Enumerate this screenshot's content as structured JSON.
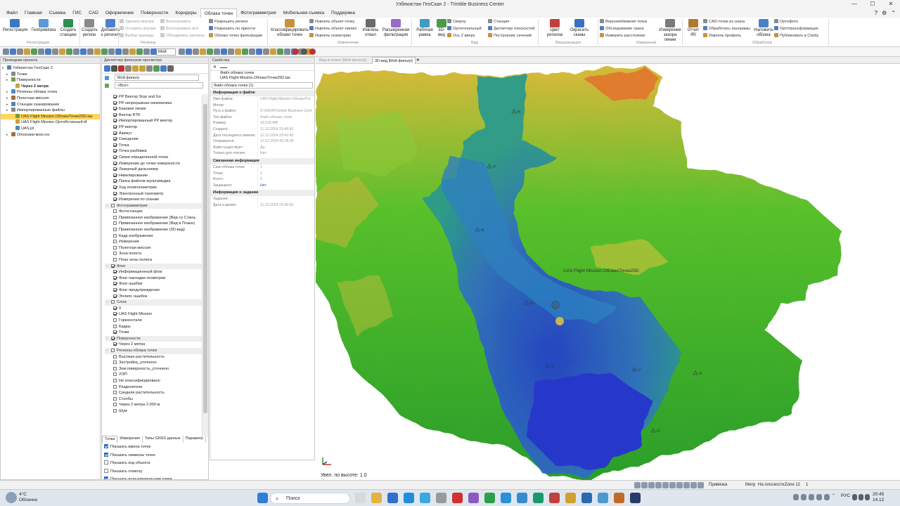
{
  "window": {
    "title": "Узбекистан ГеоСкан 2 - Trimble Business Center"
  },
  "menu": [
    "Файл",
    "Главная",
    "Съемка",
    "ГИС",
    "CAD",
    "Оформление",
    "Поверхности",
    "Коридоры",
    "Облака точек",
    "Фотограмметрия",
    "Мобильная съемка",
    "Поддержка"
  ],
  "active_menu": "Облака точек",
  "ribbon": {
    "big_buttons": [
      "Регистрация",
      "Геопривязка",
      "Создать станцию",
      "Создать регион",
      "Добавить к региону",
      "Классифицировать облако точек",
      "Извлечь отвал",
      "Расширенная фильтрация",
      "Рабочая рамка",
      "3D-вид",
      "Цвет региона",
      "Окрасить сканы",
      "Измерение зазора линии",
      "Отчет IRI",
      "Наложить облака"
    ],
    "small": {
      "col1": [
        "Удалить внутри",
        "Оставить внутри",
        "Выбор границы"
      ],
      "col2": [
        "Восстановить",
        "Восстановить все",
        "Объединить регионы"
      ],
      "col3": [
        "Разрешить регион",
        "Разрешить по яркости",
        "Облако точек фильтрации"
      ],
      "col4": [
        "Извлечь объект-точку",
        "Извлечь объект-линию",
        "Извлечь геометрию"
      ],
      "col5": [
        "Сверху",
        "Ортогональный",
        "Ось Z вверх"
      ],
      "col6": [
        "Станция",
        "Диспетчер плоскостей",
        "Построение сечений"
      ],
      "col7": [
        "Верхняя/Нижняя точка",
        "Обследование скана",
        "Измерить расстояние"
      ],
      "col8": [
        "CAD-точки из скана",
        "Обработать панорамы",
        "Извлечь профиль"
      ],
      "col9": [
        "Ортофото",
        "Ортотрансформация",
        "Публиковать в Clarity"
      ]
    },
    "groups": [
      "Регистрация",
      "Регионы",
      "Извлечение",
      "Вид",
      "Визуализация",
      "Измерение",
      "Обработка"
    ]
  },
  "toolbar": {
    "mode": "Мой"
  },
  "project_explorer": {
    "title": "Проводник проекта",
    "items": [
      {
        "label": "Узбекистан ГеоСкан 2",
        "level": 0
      },
      {
        "label": "Точки",
        "level": 1
      },
      {
        "label": "Поверхности",
        "level": 1
      },
      {
        "label": "Через 2 метра",
        "level": 2,
        "bold": true
      },
      {
        "label": "Регионы облака точек",
        "level": 1
      },
      {
        "label": "Полетная миссия",
        "level": 1
      },
      {
        "label": "Станции сканирования",
        "level": 1
      },
      {
        "label": "Импортированные файлы",
        "level": 1
      },
      {
        "label": "UAS Flight Mission.ОблакоТочек25D.las",
        "level": 2,
        "selected": true
      },
      {
        "label": "UAS Flight Mission.ОртоИстинный.tif",
        "level": 2
      },
      {
        "label": "UAS.jxl",
        "level": 2
      },
      {
        "label": "Опознаки-мои.csv",
        "level": 1
      }
    ]
  },
  "filter_manager": {
    "title": "Диспетчер фильтров просмотра",
    "filter_name": "Мой фильтр",
    "search": "<Все>",
    "rows": [
      {
        "t": "PP Вектор Stop and Go",
        "on": true
      },
      {
        "t": "PP непрерывная кинематика",
        "on": true
      },
      {
        "t": "Базовая линия",
        "on": true
      },
      {
        "t": "Вектор RTK",
        "on": true
      },
      {
        "t": "Импортированный PP вектор",
        "on": true
      },
      {
        "t": "PP вектор",
        "on": true
      },
      {
        "t": "Азимут",
        "on": true
      },
      {
        "t": "Смещение",
        "on": true
      },
      {
        "t": "Точка",
        "on": true
      },
      {
        "t": "Точка разбивки",
        "on": true
      },
      {
        "t": "Связи определенной точки",
        "on": true
      },
      {
        "t": "Измерение до точки поверхности",
        "on": true
      },
      {
        "t": "Лазерный дальномер",
        "on": true
      },
      {
        "t": "Нивелирование",
        "on": true
      },
      {
        "t": "Папка файлов мультимедиа",
        "on": true
      },
      {
        "t": "Ход полигонометрии",
        "on": true
      },
      {
        "t": "Электронный тахеометр",
        "on": true
      },
      {
        "t": "Измерения по сканам",
        "on": true
      },
      {
        "t": "Фотограмметрия",
        "on": false,
        "cat": true
      },
      {
        "t": "Фотостанция",
        "on": false
      },
      {
        "t": "Привязанное изображение (Вид со Станц",
        "on": false
      },
      {
        "t": "Привязанное изображение (Вид в Плане)",
        "on": false
      },
      {
        "t": "Привязанное изображение (3D-вид)",
        "on": false
      },
      {
        "t": "Кадр изображения",
        "on": false
      },
      {
        "t": "Измерение",
        "on": false
      },
      {
        "t": "Полетная миссия",
        "on": false
      },
      {
        "t": "Зона полета",
        "on": false
      },
      {
        "t": "План зоны полета",
        "on": false
      },
      {
        "t": "Флаг",
        "on": true,
        "cat": true
      },
      {
        "t": "Информационный флаг",
        "on": true
      },
      {
        "t": "Флаг накладки геометрии",
        "on": true
      },
      {
        "t": "Флаг ошибки",
        "on": true
      },
      {
        "t": "Флаг предупреждения",
        "on": true
      },
      {
        "t": "Эллипс ошибок",
        "on": true
      },
      {
        "t": "Слои",
        "on": false,
        "cat": true
      },
      {
        "t": "0",
        "on": true
      },
      {
        "t": "UAS Flight Mission",
        "on": true
      },
      {
        "t": "Горизонтали",
        "on": false
      },
      {
        "t": "Кадры",
        "on": false
      },
      {
        "t": "Точки",
        "on": true
      },
      {
        "t": "Поверхности",
        "on": true,
        "cat": true
      },
      {
        "t": "Через 2 метра",
        "on": true
      },
      {
        "t": "Регионы облака точек",
        "on": false,
        "cat": true
      },
      {
        "t": "Высокая растительность",
        "on": false
      },
      {
        "t": "Застройка_уточнено",
        "on": false
      },
      {
        "t": "Зем.поверхность_уточнено",
        "on": false
      },
      {
        "t": "ЛЭП",
        "on": false
      },
      {
        "t": "Не классифицировано",
        "on": false
      },
      {
        "t": "Разделители",
        "on": false
      },
      {
        "t": "Средняя растительность",
        "on": false
      },
      {
        "t": "Столбы",
        "on": false
      },
      {
        "t": "Через 2 метра 2.000 м",
        "on": false
      },
      {
        "t": "Шум",
        "on": false
      }
    ],
    "tabs": [
      "Точка",
      "Измерения",
      "Типы GNSS данных",
      "Параметр"
    ],
    "options": [
      {
        "t": "Показать имена точек",
        "on": true
      },
      {
        "t": "Показать символы точек",
        "on": true
      },
      {
        "t": "Показать код объекта",
        "on": false
      },
      {
        "t": "Показать отметку",
        "on": false
      },
      {
        "t": "Показать пользовательские точки",
        "on": true
      }
    ]
  },
  "properties": {
    "title": "Свойства",
    "object_type": "Файл облака точек",
    "object_name": "UAS Flight Mission.ОблакоТочек25D.las",
    "selector": "Файл облака точек (1)",
    "section1": "Информация о файле",
    "file_rows": [
      {
        "k": "Имя файла:",
        "v": "UAS Flight Mission.ОблакоТоч"
      },
      {
        "k": "Метки:",
        "v": ""
      },
      {
        "k": "Путь к файлу:",
        "v": "D:\\DATA\\Trimble Business Cent"
      },
      {
        "k": "Тип файла:",
        "v": "Файл облака точек"
      },
      {
        "k": "Размер:",
        "v": "39,018 MB"
      },
      {
        "k": "Создано:",
        "v": "11.12.2024 23:49:50"
      },
      {
        "k": "Дата последнего измене:",
        "v": "11.12.2024 23:42:43"
      },
      {
        "k": "Открывался:",
        "v": "12.12.2024 00:28:30"
      },
      {
        "k": "Файл существует:",
        "v": "Да"
      },
      {
        "k": "Только для чтения:",
        "v": "Нет"
      }
    ],
    "section2": "Связанная информация",
    "linked_rows": [
      {
        "k": "Скан облака точек:",
        "v": "1"
      },
      {
        "k": "Точки:",
        "v": "1"
      },
      {
        "k": "Всего:",
        "v": "2"
      },
      {
        "k": "Защищено:",
        "v": "Нет",
        "blue": true
      }
    ],
    "section3": "Информация о задании",
    "task_rows": [
      {
        "k": "Задание:",
        "v": ""
      },
      {
        "k": "Дата и время:",
        "v": "11.12.2024 23:49:50"
      }
    ]
  },
  "view_tabs": [
    "Вид в плане [Мой фильтр]",
    "3D-вид [Мой фильтр]"
  ],
  "view": {
    "layer_label": "UAS Flight Mission.ОблакоТочек25D",
    "points": [
      "t5",
      "t7",
      "t6",
      "t3",
      "t4",
      "t7",
      "t1",
      "t2"
    ],
    "scale_label": "Увел. по высоте: 1.0"
  },
  "statusbar": {
    "snap": "Привязка",
    "units": "Метр",
    "plane": "На плоскости",
    "zone": "Zone 12",
    "num": "1"
  },
  "taskbar": {
    "weather_temp": "4°C",
    "weather_desc": "Облачно",
    "search": "Поиск",
    "lang": "РУС",
    "time": "20:45",
    "date": "14.12"
  }
}
